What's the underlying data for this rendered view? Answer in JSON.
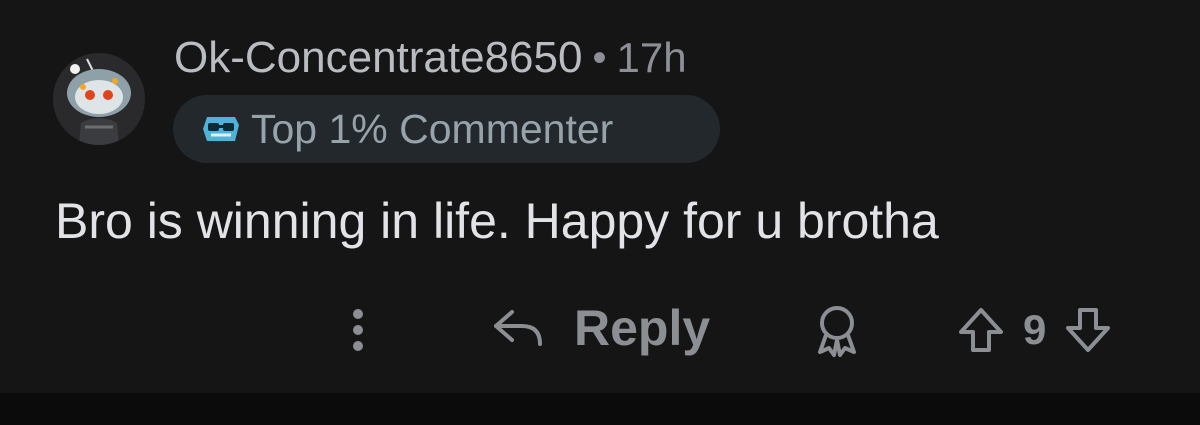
{
  "comment": {
    "username": "Ok-Concentrate8650",
    "separator": "•",
    "time": "17h",
    "flair": {
      "label": "Top 1% Commenter",
      "icon": "sunglasses-icon"
    },
    "text": "Bro is winning in life. Happy for u brotha",
    "avatar": "snoo-avatar"
  },
  "actions": {
    "more_icon": "more-vertical-icon",
    "reply_icon": "reply-arrow-icon",
    "reply_label": "Reply",
    "award_icon": "award-icon",
    "upvote_icon": "upvote-arrow-icon",
    "vote_count": "9",
    "downvote_icon": "downvote-arrow-icon"
  },
  "colors": {
    "background": "#151516",
    "text_primary": "#e1e3e6",
    "text_secondary": "#8b8e93",
    "flair_bg": "#22282c"
  }
}
